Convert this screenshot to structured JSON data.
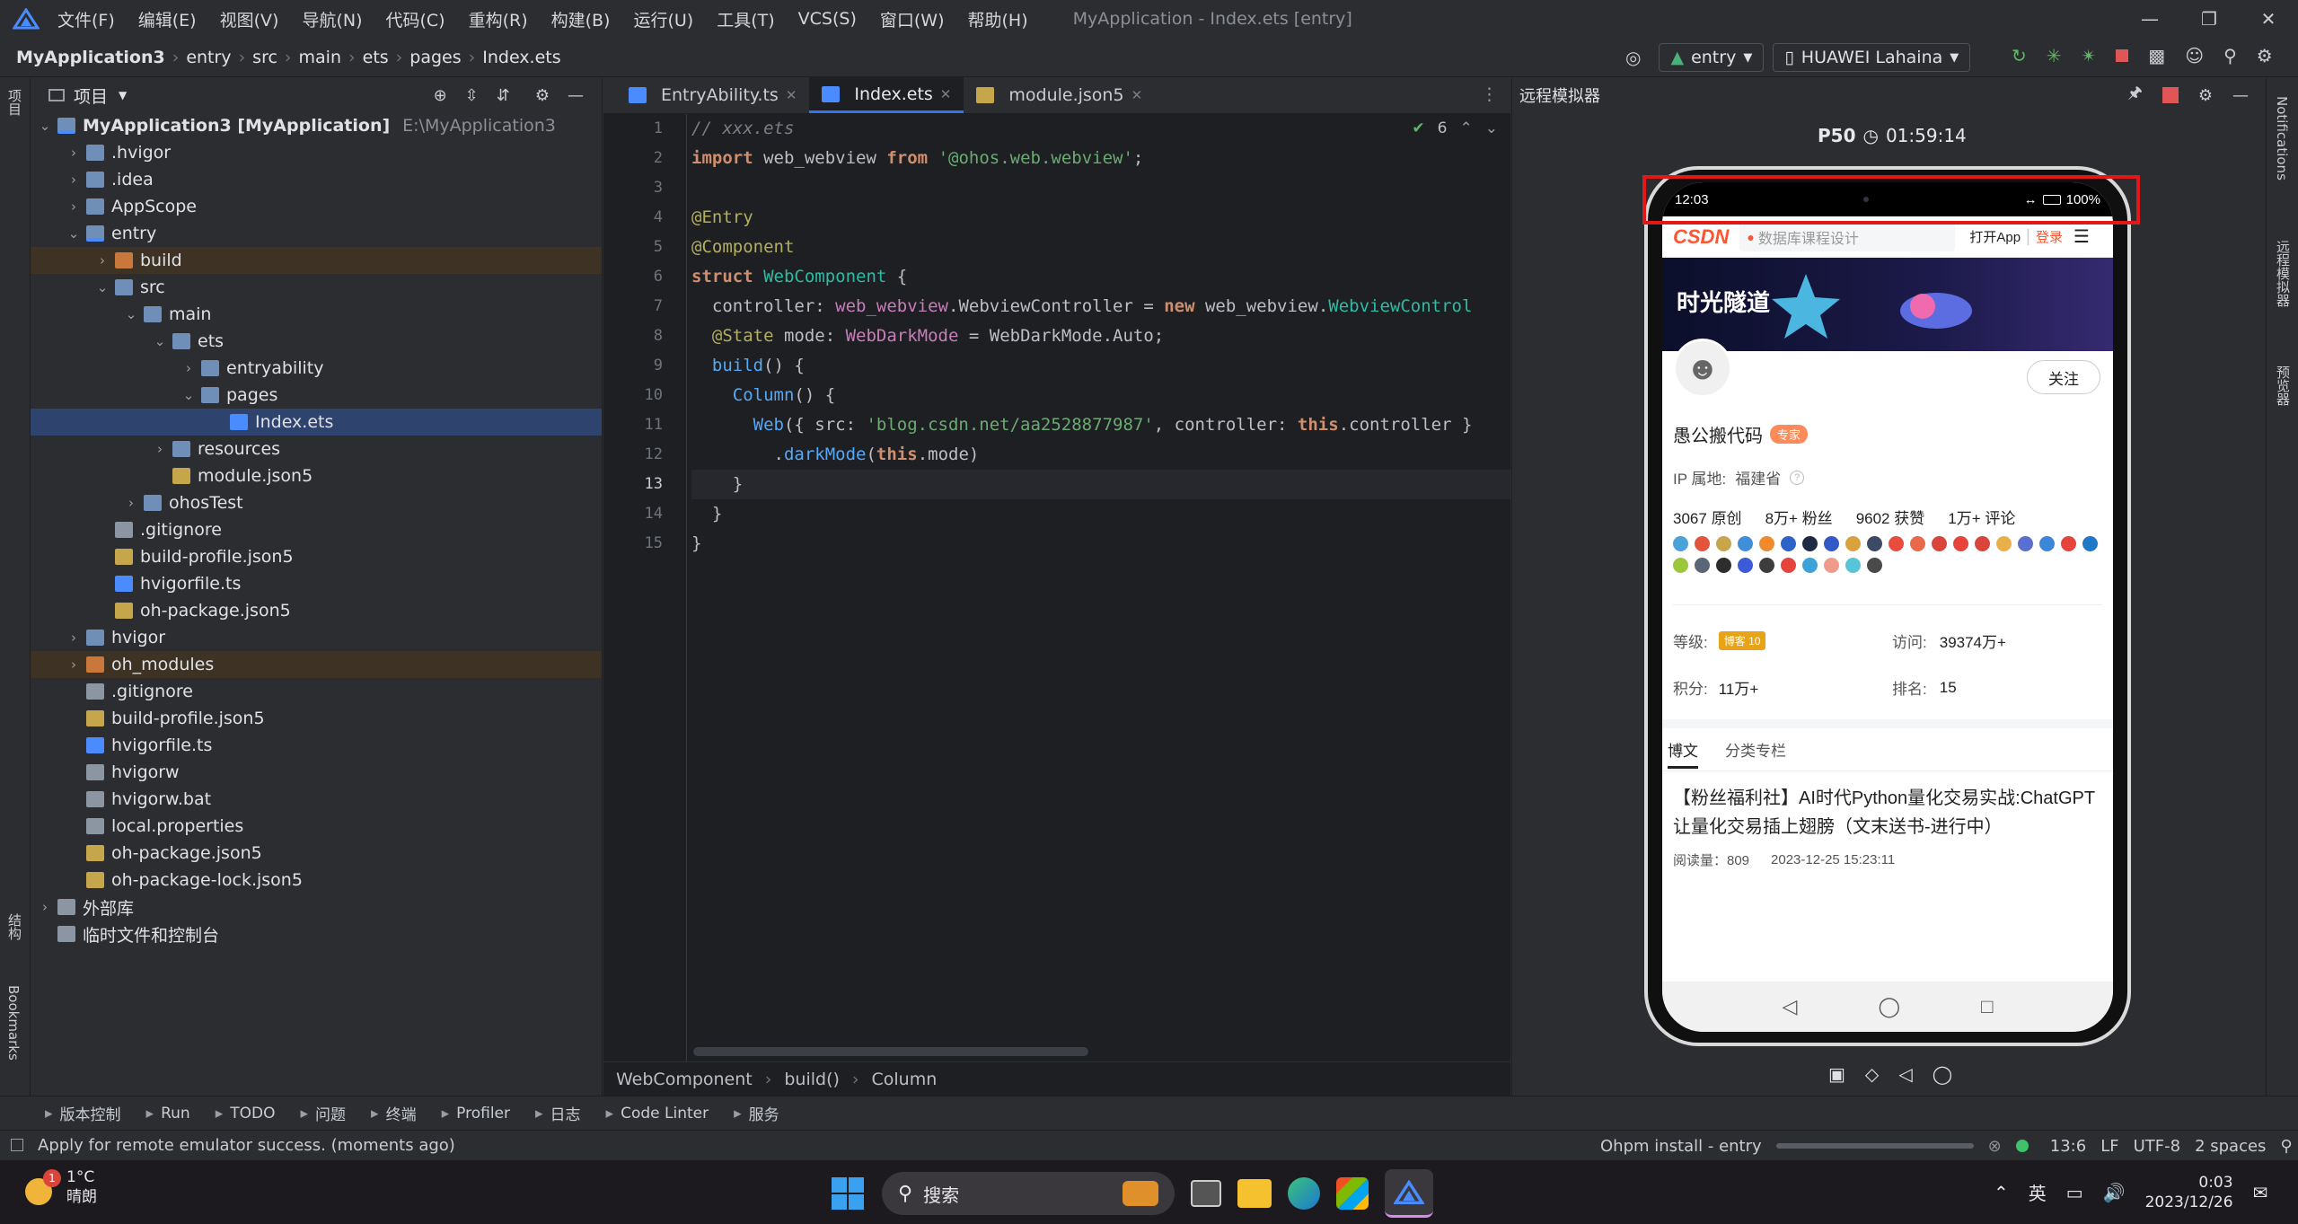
{
  "menu": {
    "items": [
      "文件(F)",
      "编辑(E)",
      "视图(V)",
      "导航(N)",
      "代码(C)",
      "重构(R)",
      "构建(B)",
      "运行(U)",
      "工具(T)",
      "VCS(S)",
      "窗口(W)",
      "帮助(H)"
    ],
    "window_title": "MyApplication - Index.ets [entry]"
  },
  "breadcrumb": [
    "MyApplication3",
    "entry",
    "src",
    "main",
    "ets",
    "pages",
    "Index.ets"
  ],
  "toolbar": {
    "module": "entry",
    "device": "HUAWEI Lahaina"
  },
  "project_panel": {
    "title": "项目",
    "tree": [
      {
        "label": "MyApplication3 [MyApplication]",
        "extra": "E:\\MyApplication3",
        "depth": 0,
        "chev": "v",
        "icon": "folder mod",
        "cls": ""
      },
      {
        "label": ".hvigor",
        "depth": 1,
        "chev": ">",
        "icon": "folder",
        "cls": ""
      },
      {
        "label": ".idea",
        "depth": 1,
        "chev": ">",
        "icon": "folder",
        "cls": ""
      },
      {
        "label": "AppScope",
        "depth": 1,
        "chev": ">",
        "icon": "folder",
        "cls": ""
      },
      {
        "label": "entry",
        "depth": 1,
        "chev": "v",
        "icon": "folder mod",
        "cls": ""
      },
      {
        "label": "build",
        "depth": 2,
        "chev": ">",
        "icon": "folder orange",
        "cls": "hl"
      },
      {
        "label": "src",
        "depth": 2,
        "chev": "v",
        "icon": "folder",
        "cls": ""
      },
      {
        "label": "main",
        "depth": 3,
        "chev": "v",
        "icon": "folder",
        "cls": ""
      },
      {
        "label": "ets",
        "depth": 4,
        "chev": "v",
        "icon": "folder",
        "cls": ""
      },
      {
        "label": "entryability",
        "depth": 5,
        "chev": ">",
        "icon": "folder",
        "cls": ""
      },
      {
        "label": "pages",
        "depth": 5,
        "chev": "v",
        "icon": "folder",
        "cls": ""
      },
      {
        "label": "Index.ets",
        "depth": 6,
        "chev": "",
        "icon": "file ts",
        "cls": "sel"
      },
      {
        "label": "resources",
        "depth": 4,
        "chev": ">",
        "icon": "folder",
        "cls": ""
      },
      {
        "label": "module.json5",
        "depth": 4,
        "chev": "",
        "icon": "file json",
        "cls": ""
      },
      {
        "label": "ohosTest",
        "depth": 3,
        "chev": ">",
        "icon": "folder",
        "cls": ""
      },
      {
        "label": ".gitignore",
        "depth": 2,
        "chev": "",
        "icon": "file",
        "cls": ""
      },
      {
        "label": "build-profile.json5",
        "depth": 2,
        "chev": "",
        "icon": "file json",
        "cls": ""
      },
      {
        "label": "hvigorfile.ts",
        "depth": 2,
        "chev": "",
        "icon": "file ts",
        "cls": ""
      },
      {
        "label": "oh-package.json5",
        "depth": 2,
        "chev": "",
        "icon": "file json",
        "cls": ""
      },
      {
        "label": "hvigor",
        "depth": 1,
        "chev": ">",
        "icon": "folder",
        "cls": ""
      },
      {
        "label": "oh_modules",
        "depth": 1,
        "chev": ">",
        "icon": "folder orange",
        "cls": "hl"
      },
      {
        "label": ".gitignore",
        "depth": 1,
        "chev": "",
        "icon": "file",
        "cls": ""
      },
      {
        "label": "build-profile.json5",
        "depth": 1,
        "chev": "",
        "icon": "file json",
        "cls": ""
      },
      {
        "label": "hvigorfile.ts",
        "depth": 1,
        "chev": "",
        "icon": "file ts",
        "cls": ""
      },
      {
        "label": "hvigorw",
        "depth": 1,
        "chev": "",
        "icon": "file",
        "cls": ""
      },
      {
        "label": "hvigorw.bat",
        "depth": 1,
        "chev": "",
        "icon": "file",
        "cls": ""
      },
      {
        "label": "local.properties",
        "depth": 1,
        "chev": "",
        "icon": "file",
        "cls": ""
      },
      {
        "label": "oh-package.json5",
        "depth": 1,
        "chev": "",
        "icon": "file json",
        "cls": ""
      },
      {
        "label": "oh-package-lock.json5",
        "depth": 1,
        "chev": "",
        "icon": "file json",
        "cls": ""
      },
      {
        "label": "外部库",
        "depth": 0,
        "chev": ">",
        "icon": "file",
        "cls": ""
      },
      {
        "label": "临时文件和控制台",
        "depth": 0,
        "chev": "",
        "icon": "file",
        "cls": ""
      }
    ]
  },
  "left_strip": {
    "top": "项目",
    "mid": "结构",
    "bottom": "Bookmarks"
  },
  "editor": {
    "tabs": [
      {
        "label": "EntryAbility.ts",
        "active": false
      },
      {
        "label": "Index.ets",
        "active": true
      },
      {
        "label": "module.json5",
        "active": false
      }
    ],
    "inspections": "6",
    "lines": [
      [
        [
          "cm",
          "// xxx.ets"
        ]
      ],
      [
        [
          "kw",
          "import "
        ],
        [
          "plain",
          "web_webview "
        ],
        [
          "kw",
          "from "
        ],
        [
          "str",
          "'@ohos.web.webview'"
        ],
        [
          "plain",
          ";"
        ]
      ],
      [],
      [
        [
          "dec",
          "@Entry"
        ]
      ],
      [
        [
          "dec",
          "@Component"
        ]
      ],
      [
        [
          "kw",
          "struct "
        ],
        [
          "cls",
          "WebComponent "
        ],
        [
          "plain",
          "{"
        ]
      ],
      [
        [
          "plain",
          "  controller: "
        ],
        [
          "ty",
          "web_webview"
        ],
        [
          "plain",
          ".WebviewController = "
        ],
        [
          "kw",
          "new "
        ],
        [
          "plain",
          "web_webview."
        ],
        [
          "cls",
          "WebviewControl"
        ]
      ],
      [
        [
          "dec",
          "  @State "
        ],
        [
          "plain",
          "mode: "
        ],
        [
          "ty",
          "WebDarkMode"
        ],
        [
          "plain",
          " = WebDarkMode.Auto;"
        ]
      ],
      [
        [
          "fn",
          "  build"
        ],
        [
          "plain",
          "() {"
        ]
      ],
      [
        [
          "fn",
          "    Column"
        ],
        [
          "plain",
          "() {"
        ]
      ],
      [
        [
          "fn",
          "      Web"
        ],
        [
          "plain",
          "({ src: "
        ],
        [
          "str",
          "'blog.csdn.net/aa2528877987'"
        ],
        [
          "plain",
          ", controller: "
        ],
        [
          "kw",
          "this"
        ],
        [
          "plain",
          ".controller }"
        ]
      ],
      [
        [
          "plain",
          "        ."
        ],
        [
          "fn",
          "darkMode"
        ],
        [
          "plain",
          "("
        ],
        [
          "kw",
          "this"
        ],
        [
          "plain",
          ".mode)"
        ]
      ],
      [
        [
          "plain",
          "    }"
        ]
      ],
      [
        [
          "plain",
          "  }"
        ]
      ],
      [
        [
          "plain",
          "}"
        ]
      ]
    ],
    "current_line": 13,
    "footer_crumb": [
      "WebComponent",
      "build()",
      "Column"
    ]
  },
  "emulator": {
    "title": "远程模拟器",
    "device_name": "P50",
    "timer": "01:59:14",
    "phone": {
      "time": "12:03",
      "battery": "100%",
      "csdn_logo": "CSDN",
      "search_placeholder": "数据库课程设计",
      "open_app": "打开App",
      "login": "登录",
      "banner_text": "时光隧道",
      "follow": "关注",
      "username": "愚公搬代码",
      "expert_badge": "专家",
      "ip_label": "IP 属地:",
      "ip_value": "福建省",
      "stats": [
        {
          "num": "3067",
          "label": "原创"
        },
        {
          "num": "8万+",
          "label": "粉丝"
        },
        {
          "num": "9602",
          "label": "获赞"
        },
        {
          "num": "1万+",
          "label": "评论"
        }
      ],
      "badge_colors": [
        "#4aa3d8",
        "#e5533d",
        "#c8a54a",
        "#3f8fd8",
        "#f08a2b",
        "#2d63c8",
        "#1f2a44",
        "#3359c9",
        "#d9a23b",
        "#3d4a66",
        "#e94b3c",
        "#e96a4a",
        "#d9443b",
        "#e5433c",
        "#d9443b",
        "#e9b04a",
        "#5a6fd1",
        "#3b86d9",
        "#e5433c",
        "#1f78c8",
        "#9bc73a",
        "#5a6675",
        "#2d2d2d",
        "#3b5bd9",
        "#3d3d3d",
        "#e5433c",
        "#3ba3d9",
        "#f09a8a",
        "#56c5d9",
        "#4a4a4a"
      ],
      "level_label": "等级:",
      "level_badge": "博客 10",
      "visits_label": "访问:",
      "visits_value": "39374万+",
      "points_label": "积分:",
      "points_value": "11万+",
      "rank_label": "排名:",
      "rank_value": "15",
      "tabs": [
        "博文",
        "分类专栏"
      ],
      "post_title": "【粉丝福利社】AI时代Python量化交易实战:ChatGPT让量化交易插上翅膀（文末送书-进行中）",
      "post_reads": "阅读量：809",
      "post_date": "2023-12-25 15:23:11"
    }
  },
  "right_strip": {
    "notifications": "Notifications",
    "remote": "远程模拟器",
    "preview": "预览器"
  },
  "bottom_tools": [
    {
      "label": "版本控制",
      "icon": "branch-icon"
    },
    {
      "label": "Run",
      "icon": "run-icon"
    },
    {
      "label": "TODO",
      "icon": "todo-icon"
    },
    {
      "label": "问题",
      "icon": "problems-icon"
    },
    {
      "label": "终端",
      "icon": "terminal-icon"
    },
    {
      "label": "Profiler",
      "icon": "profiler-icon"
    },
    {
      "label": "日志",
      "icon": "log-icon"
    },
    {
      "label": "Code Linter",
      "icon": "linter-icon"
    },
    {
      "label": "服务",
      "icon": "services-icon"
    }
  ],
  "status": {
    "message": "Apply for remote emulator success. (moments ago)",
    "task": "Ohpm install - entry",
    "position": "13:6",
    "line_sep": "LF",
    "encoding": "UTF-8",
    "indent": "2 spaces"
  },
  "taskbar": {
    "weather_temp": "1°C",
    "weather_desc": "晴朗",
    "weather_badge": "1",
    "search": "搜索",
    "ime": "英",
    "time": "0:03",
    "date": "2023/12/26"
  }
}
